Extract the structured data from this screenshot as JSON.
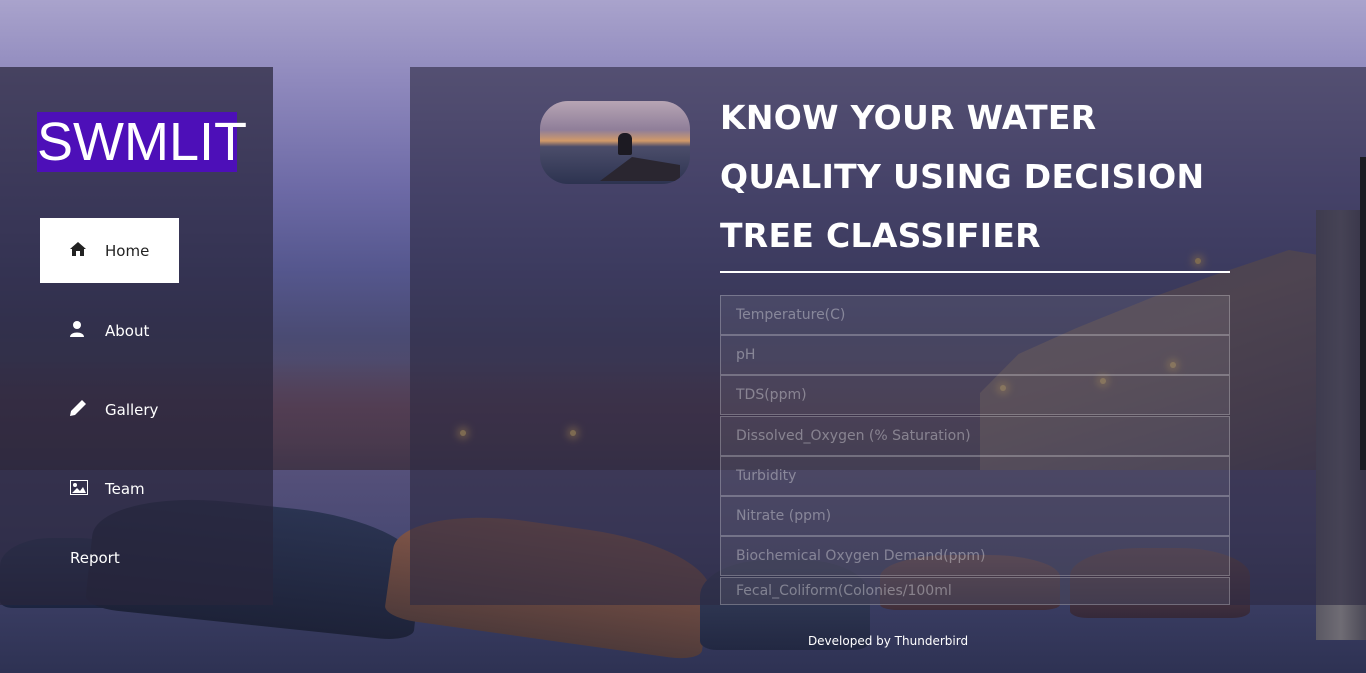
{
  "brand": {
    "logo_text": "SWMLIT",
    "color": "#4d0fb8"
  },
  "sidebar": {
    "items": [
      {
        "label": "Home",
        "icon": "home-icon",
        "active": true
      },
      {
        "label": "About",
        "icon": "user-icon",
        "active": false
      },
      {
        "label": "Gallery",
        "icon": "pencil-icon",
        "active": false
      },
      {
        "label": "Team",
        "icon": "image-icon",
        "active": false
      },
      {
        "label": "Report",
        "icon": "",
        "active": false
      }
    ]
  },
  "main": {
    "title_lines": [
      "KNOW YOUR WATER",
      "QUALITY USING DECISION",
      "TREE CLASSIFIER"
    ],
    "fields": [
      {
        "placeholder": "Temperature(C)",
        "value": ""
      },
      {
        "placeholder": "pH",
        "value": ""
      },
      {
        "placeholder": "TDS(ppm)",
        "value": ""
      },
      {
        "placeholder": "Dissolved_Oxygen (% Saturation)",
        "value": ""
      },
      {
        "placeholder": "Turbidity",
        "value": ""
      },
      {
        "placeholder": "Nitrate (ppm)",
        "value": ""
      },
      {
        "placeholder": "Biochemical Oxygen Demand(ppm)",
        "value": ""
      },
      {
        "placeholder": "Fecal_Coliform(Colonies/100ml",
        "value": ""
      }
    ]
  },
  "footer": {
    "text": "Developed by Thunderbird"
  }
}
